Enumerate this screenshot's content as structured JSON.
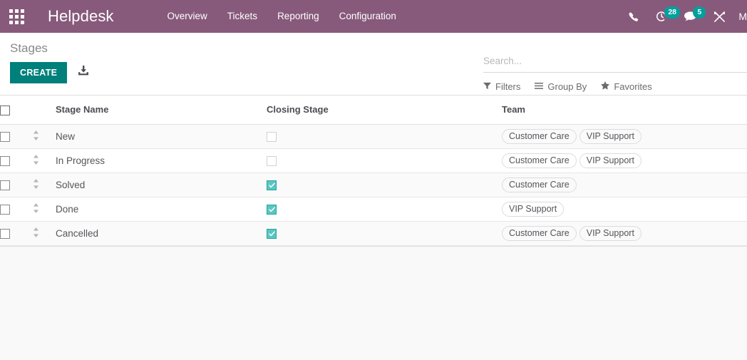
{
  "navbar": {
    "apps_icon": "apps-grid-icon",
    "brand": "Helpdesk",
    "menu": [
      {
        "label": "Overview"
      },
      {
        "label": "Tickets"
      },
      {
        "label": "Reporting"
      },
      {
        "label": "Configuration"
      }
    ],
    "systray": {
      "phone_icon": "phone-icon",
      "activity_icon": "clock-activity-icon",
      "activity_count": "28",
      "messages_icon": "speech-bubble-icon",
      "messages_count": "5",
      "tools_icon": "tools-icon",
      "user_initial": "M"
    },
    "colors": {
      "navbar_bg": "#875a7b",
      "badge_bg": "#00a09d"
    }
  },
  "control_panel": {
    "breadcrumb": "Stages",
    "create_label": "CREATE",
    "import_icon": "import-download-icon",
    "create_color": "#00807b",
    "search": {
      "placeholder": "Search...",
      "value": ""
    },
    "filters": [
      {
        "label": "Filters",
        "icon": "funnel-icon"
      },
      {
        "label": "Group By",
        "icon": "hamburger-lines-icon"
      },
      {
        "label": "Favorites",
        "icon": "star-icon"
      }
    ]
  },
  "table": {
    "columns": {
      "stage_name": "Stage Name",
      "closing_stage": "Closing Stage",
      "team": "Team"
    },
    "rows": [
      {
        "name": "New",
        "closing": false,
        "teams": [
          "Customer Care",
          "VIP Support"
        ]
      },
      {
        "name": "In Progress",
        "closing": false,
        "teams": [
          "Customer Care",
          "VIP Support"
        ]
      },
      {
        "name": "Solved",
        "closing": true,
        "teams": [
          "Customer Care"
        ]
      },
      {
        "name": "Done",
        "closing": true,
        "teams": [
          "VIP Support"
        ]
      },
      {
        "name": "Cancelled",
        "closing": true,
        "teams": [
          "Customer Care",
          "VIP Support"
        ]
      }
    ],
    "checkbox_on_color": "#5dc5c1"
  }
}
